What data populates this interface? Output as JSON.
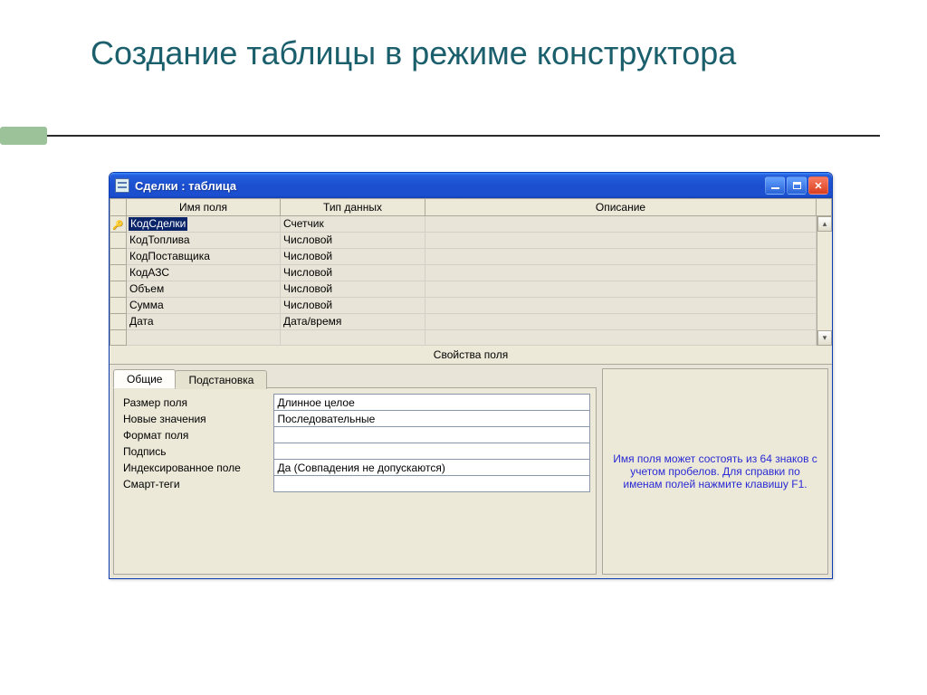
{
  "slide": {
    "title": "Создание таблицы в режиме конструктора"
  },
  "window": {
    "title": "Сделки : таблица",
    "grid": {
      "headers": {
        "name": "Имя поля",
        "type": "Тип данных",
        "desc": "Описание"
      },
      "rows": [
        {
          "key": true,
          "selected": true,
          "name": "КодСделки",
          "type": "Счетчик",
          "desc": ""
        },
        {
          "key": false,
          "selected": false,
          "name": "КодТоплива",
          "type": "Числовой",
          "desc": ""
        },
        {
          "key": false,
          "selected": false,
          "name": "КодПоставщика",
          "type": "Числовой",
          "desc": ""
        },
        {
          "key": false,
          "selected": false,
          "name": "КодАЗС",
          "type": "Числовой",
          "desc": ""
        },
        {
          "key": false,
          "selected": false,
          "name": "Объем",
          "type": "Числовой",
          "desc": ""
        },
        {
          "key": false,
          "selected": false,
          "name": "Сумма",
          "type": "Числовой",
          "desc": ""
        },
        {
          "key": false,
          "selected": false,
          "name": "Дата",
          "type": "Дата/время",
          "desc": ""
        },
        {
          "key": false,
          "selected": false,
          "name": "",
          "type": "",
          "desc": ""
        }
      ]
    },
    "properties_header": "Свойства поля",
    "tabs": {
      "general": "Общие",
      "lookup": "Подстановка"
    },
    "properties": [
      {
        "label": "Размер поля",
        "value": "Длинное целое"
      },
      {
        "label": "Новые значения",
        "value": "Последовательные"
      },
      {
        "label": "Формат поля",
        "value": ""
      },
      {
        "label": "Подпись",
        "value": ""
      },
      {
        "label": "Индексированное поле",
        "value": "Да (Совпадения не допускаются)"
      },
      {
        "label": "Смарт-теги",
        "value": ""
      }
    ],
    "help_text": "Имя поля может состоять из 64 знаков с учетом пробелов.  Для справки по именам полей нажмите клавишу F1."
  }
}
